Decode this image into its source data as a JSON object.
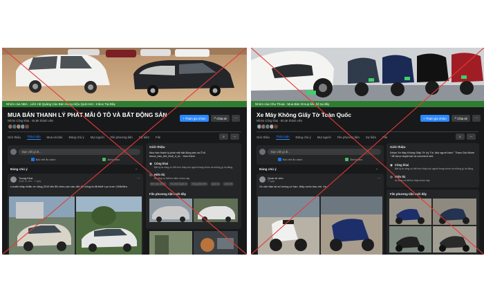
{
  "left_group": {
    "ribbon_text": "Nhóm của NBA - Liên Hệ Quảng Cáo Bán Hàng Hiệu Quả Hơn - Inbox Tại Đây",
    "title": "MUA BÁN THANH LÝ PHÁT MÃI Ô TÔ VÀ BẤT ĐỘNG SẢN",
    "meta": "Nhóm Công khai · 46,8K thành viên",
    "join_label": "Tham gia nhóm",
    "share_label": "Chia sẻ",
    "more_label": "⋯",
    "tabs": [
      "Giới thiệu",
      "Thảo luận",
      "Mua và bán",
      "Đáng chú ý",
      "Mọi người",
      "File phương tiện",
      "Sự kiện",
      "File"
    ],
    "search_icon": "search-icon",
    "compose_placeholder": "Bạn viết gì đi...",
    "compose_actions": [
      "Bài viết ẩn danh",
      "Ảnh/video"
    ],
    "featured_label": "Đáng chú ý",
    "post": {
      "author": "Tuong Khai",
      "time": "Quản trị viên · 1 ngày",
      "text": "Lucsitt nhập khẩu xe cũng,2019 lăn 58 chức,các xác vẫn để cũng là đã thiết Lục lươn 100k/tiều"
    },
    "about_title": "Giới thiệu",
    "about_text": "Mua bán thanh lý phát mãi bất động sản và Ô tô #mua_bán_ôtô_thuê_ô_tô... Xem thêm",
    "public_title": "Công khai",
    "public_desc": "Bất kỳ ai cũng có thể nhìn thấy mọi người trong nhóm và những gì họ đăng.",
    "visible_title": "Hiển thị",
    "visible_desc": "Ai cũng có thể tìm kiếm nhóm này.",
    "tags": [
      "Bến tour đánh",
      "Trò chơi Quân trị",
      "Trang Bất viên",
      "Quản lý",
      "Liên Kết"
    ],
    "media_title": "File phương tiện mới đây"
  },
  "right_group": {
    "ribbon_text": "Nhóm của Chu Thoại - Mua Bán Group liên hệ tại đây",
    "title": "Xe Máy Không Giấy Tờ Toàn Quốc",
    "meta": "Nhóm Công khai · 80,4K thành viên",
    "join_label": "Tham gia nhóm",
    "share_label": "Chia sẻ",
    "more_label": "⋯",
    "tabs": [
      "Giới thiệu",
      "Thảo luận",
      "Đáng chú ý",
      "Mọi người",
      "File phương tiện",
      "Sự kiện",
      "File"
    ],
    "search_icon": "search-icon",
    "compose_placeholder": "Bạn viết gì đi...",
    "compose_actions": [
      "Bài viết ẩn danh",
      "Ảnh/video"
    ],
    "featured_label": "Đáng chú ý",
    "post": {
      "author": "Quản trị viên",
      "time": "1 ngày",
      "text": "Xe cần bán lại số lượng có hạn. Máy nước bao chi. Xe..."
    },
    "about_title": "Giới thiệu",
    "about_text": "Nhóm Xe Máy Không Giấy Tờ Uy Tín. Mọi người bấm \" Tham Gia Nhóm \" để được duyệt bài và comment nhé.",
    "public_title": "Công khai",
    "public_desc": "Bất kỳ ai cũng có thể nhìn thấy mọi người trong nhóm và những gì họ đăng.",
    "visible_title": "Hiển thị",
    "visible_desc": "Ai cũng có thể tìm thấy nhóm này.",
    "media_title": "File phương tiện mới đây"
  },
  "colors": {
    "cross": "#e53935",
    "accent": "#2d88ff",
    "ribbon": "#2e7d32",
    "panel_bg": "#18191a",
    "card_bg": "#242526"
  }
}
